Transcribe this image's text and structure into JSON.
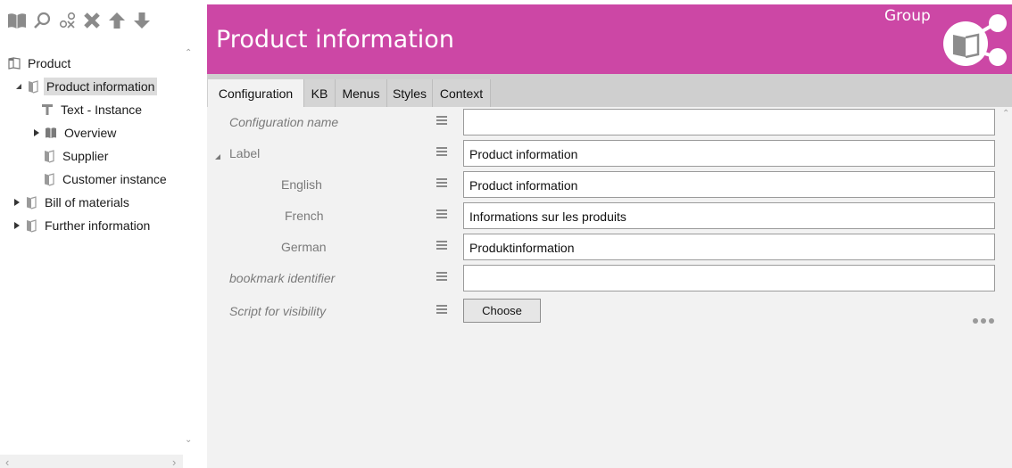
{
  "toolbar": {
    "icons": [
      "open-book-icon",
      "search-icon",
      "filter-x-icon",
      "delete-icon",
      "move-up-icon",
      "move-down-icon"
    ]
  },
  "tree": {
    "items": [
      {
        "label": "Product",
        "icon": "closed-book-icon",
        "level": 0,
        "expander": "none"
      },
      {
        "label": "Product information",
        "icon": "book-icon",
        "level": 1,
        "expander": "expanded",
        "selected": true
      },
      {
        "label": "Text - Instance",
        "icon": "text-icon",
        "level": 2,
        "expander": "none"
      },
      {
        "label": "Overview",
        "icon": "dark-book-icon",
        "level": 2,
        "expander": "collapsed"
      },
      {
        "label": "Supplier",
        "icon": "book-icon",
        "level": 2,
        "expander": "none"
      },
      {
        "label": "Customer instance",
        "icon": "book-icon",
        "level": 2,
        "expander": "none"
      },
      {
        "label": "Bill of materials",
        "icon": "book-icon",
        "level": 1,
        "expander": "collapsed"
      },
      {
        "label": "Further information",
        "icon": "book-icon",
        "level": 1,
        "expander": "collapsed"
      }
    ]
  },
  "header": {
    "title": "Product information",
    "group_label": "Group",
    "group_icon": "group-share-icon",
    "color": "#cc47a5"
  },
  "tabs": [
    {
      "label": "Configuration",
      "active": true
    },
    {
      "label": "KB",
      "active": false
    },
    {
      "label": "Menus",
      "active": false
    },
    {
      "label": "Styles",
      "active": false
    },
    {
      "label": "Context",
      "active": false
    }
  ],
  "form": {
    "config_name": {
      "label": "Configuration name",
      "value": ""
    },
    "label": {
      "label": "Label",
      "value": "Product information"
    },
    "english": {
      "label": "English",
      "value": "Product information"
    },
    "french": {
      "label": "French",
      "value": "Informations sur les produits"
    },
    "german": {
      "label": "German",
      "value": "Produktinformation"
    },
    "bookmark": {
      "label": "bookmark identifier",
      "value": ""
    },
    "script": {
      "label": "Script for visibility",
      "button": "Choose"
    }
  }
}
